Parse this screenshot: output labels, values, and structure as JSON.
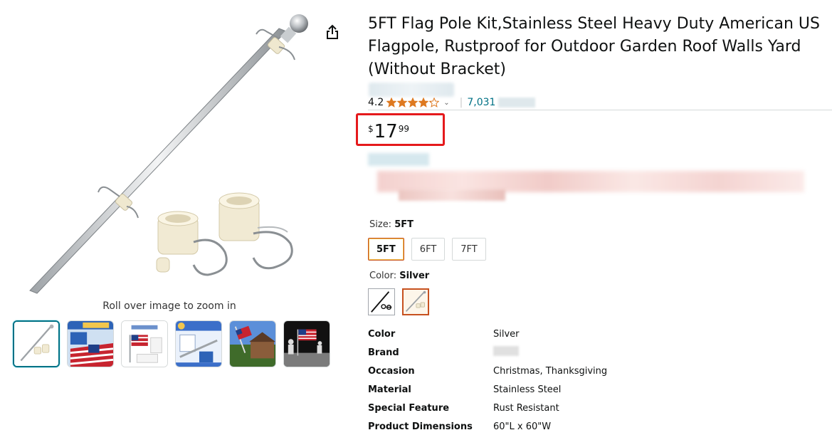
{
  "gallery": {
    "zoom_hint": "Roll over image to zoom in",
    "thumbnails": [
      {
        "name": "thumb-pole-kit",
        "selected": true
      },
      {
        "name": "thumb-kit-banner",
        "selected": false,
        "caption": "5FT FLAG POLE KIT"
      },
      {
        "name": "thumb-flag-mount",
        "selected": false
      },
      {
        "name": "thumb-parts-list",
        "selected": false
      },
      {
        "name": "thumb-house-flag",
        "selected": false
      },
      {
        "name": "thumb-moon-flag",
        "selected": false
      }
    ]
  },
  "product": {
    "title": "5FT Flag Pole Kit,Stainless Steel Heavy Duty American US Flagpole, Rustproof for Outdoor Garden Roof Walls Yard (Without Bracket)",
    "rating": "4.2",
    "stars_value": 4.2,
    "review_count": "7,031",
    "price": {
      "symbol": "$",
      "whole": "17",
      "fraction": "99"
    }
  },
  "size": {
    "label": "Size:",
    "selected": "5FT",
    "options": [
      "5FT",
      "6FT",
      "7FT"
    ]
  },
  "color": {
    "label": "Color:",
    "selected": "Silver",
    "swatches": [
      "black",
      "silver"
    ]
  },
  "specs": [
    {
      "key": "Color",
      "value": "Silver"
    },
    {
      "key": "Brand",
      "value": ""
    },
    {
      "key": "Occasion",
      "value": "Christmas, Thanksgiving"
    },
    {
      "key": "Material",
      "value": "Stainless Steel"
    },
    {
      "key": "Special Feature",
      "value": "Rust Resistant"
    },
    {
      "key": "Product Dimensions",
      "value": "60\"L x 60\"W"
    }
  ],
  "colors": {
    "link": "#007185",
    "star": "#de7921",
    "highlight_box": "#e5191c",
    "selected_border": "#c7511f"
  }
}
